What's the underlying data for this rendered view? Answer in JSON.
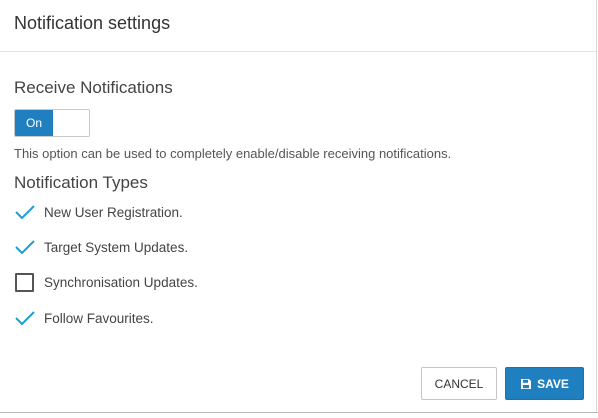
{
  "dialog": {
    "title": "Notification settings"
  },
  "receive": {
    "heading": "Receive Notifications",
    "toggle_label": "On",
    "toggle_state": "on",
    "help_text": "This option can be used to completely enable/disable receiving notifications."
  },
  "types": {
    "heading": "Notification Types",
    "items": [
      {
        "label": "New User Registration.",
        "checked": true
      },
      {
        "label": "Target System Updates.",
        "checked": true
      },
      {
        "label": "Synchronisation Updates.",
        "checked": false
      },
      {
        "label": "Follow Favourites.",
        "checked": true
      }
    ]
  },
  "footer": {
    "cancel_label": "CANCEL",
    "save_label": "SAVE",
    "save_icon": "floppy-disk-icon"
  },
  "colors": {
    "accent": "#1f7fbf",
    "check": "#1a9fcf"
  }
}
